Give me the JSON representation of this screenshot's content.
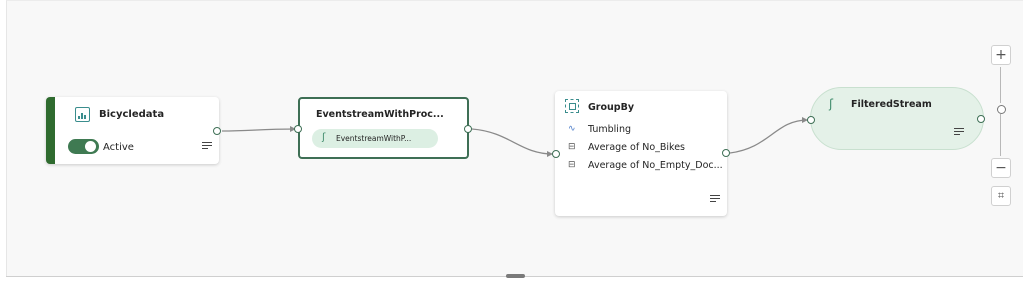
{
  "nodes": {
    "source": {
      "title": "Bicycledata",
      "toggle_label": "Active",
      "toggle_on": true
    },
    "eventstream": {
      "title": "EventstreamWithProc...",
      "stream_label": "EventstreamWithP..."
    },
    "groupby": {
      "title": "GroupBy",
      "rows": [
        {
          "icon": "tumbling-window-icon",
          "label": "Tumbling"
        },
        {
          "icon": "aggregate-icon",
          "label": "Average of No_Bikes"
        },
        {
          "icon": "aggregate-icon",
          "label": "Average of No_Empty_Doc..."
        }
      ]
    },
    "destination": {
      "title": "FilteredStream"
    }
  },
  "zoom": {
    "zoom_in_label": "+",
    "zoom_out_label": "−",
    "fit_label": "⌗"
  },
  "colors": {
    "accent_green": "#2f6b2f",
    "node_border": "#3e6f55",
    "destination_fill": "#e4f1e8",
    "canvas": "#f8f8f8"
  }
}
